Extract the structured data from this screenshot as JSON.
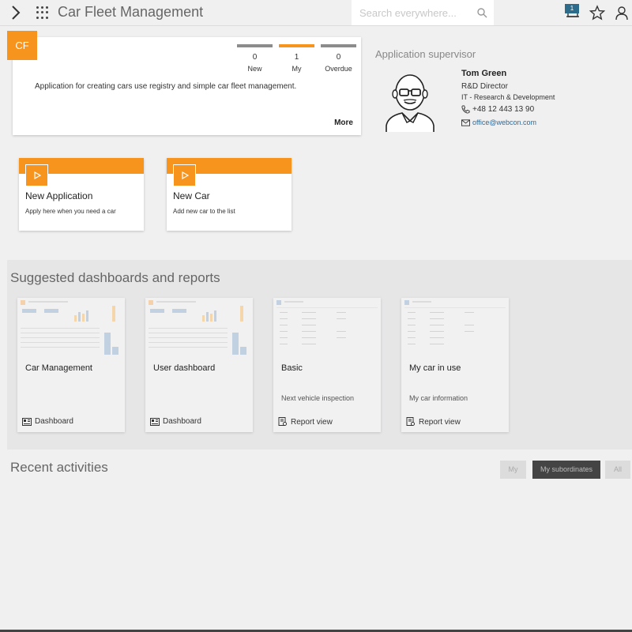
{
  "header": {
    "title": "Car Fleet Management",
    "search_placeholder": "Search everywhere...",
    "notification_count": "1",
    "icons": [
      "chevron-right-icon",
      "apps-grid-icon",
      "search-icon",
      "bell-icon",
      "star-icon",
      "user-icon"
    ]
  },
  "app_card": {
    "badge": "CF",
    "counters": [
      {
        "value": "0",
        "label": "New"
      },
      {
        "value": "1",
        "label": "My"
      },
      {
        "value": "0",
        "label": "Overdue"
      }
    ],
    "description": "Application for creating cars use registry and simple car fleet management.",
    "more_label": "More"
  },
  "supervisor": {
    "title": "Application supervisor",
    "name": "Tom Green",
    "role": "R&D Director",
    "department": "IT - Research & Development",
    "phone": "+48 12 443 13 90",
    "email": "office@webcon.com"
  },
  "actions": [
    {
      "title": "New Application",
      "subtitle": "Apply here when you need a car"
    },
    {
      "title": "New Car",
      "subtitle": "Add new car to the list"
    }
  ],
  "suggested": {
    "title": "Suggested dashboards and reports",
    "cards": [
      {
        "title": "Car Management",
        "subtitle": "",
        "footer": "Dashboard"
      },
      {
        "title": "User dashboard",
        "subtitle": "",
        "footer": "Dashboard"
      },
      {
        "title": "Basic",
        "subtitle": "Next vehicle inspection",
        "footer": "Report view"
      },
      {
        "title": "My car in use",
        "subtitle": "My car information",
        "footer": "Report view"
      }
    ]
  },
  "recent": {
    "title": "Recent activities",
    "filters": [
      "My",
      "My subordinates",
      "All"
    ],
    "active_filter": "My subordinates"
  },
  "colors": {
    "accent": "#f7941d",
    "link": "#2c6b9c",
    "badge": "#2c6b8a"
  }
}
